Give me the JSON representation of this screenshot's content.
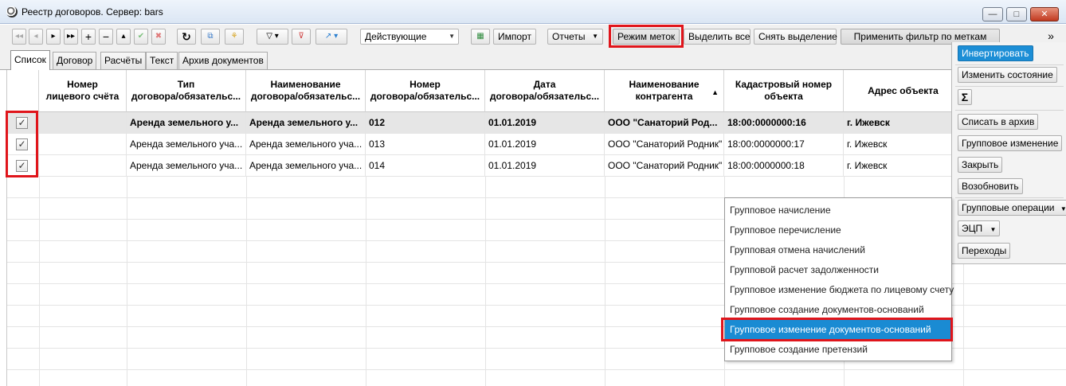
{
  "window": {
    "title": "Реестр договоров. Сервер: bars"
  },
  "toolbar": {
    "status_filter": "Действующие",
    "import_label": "Импорт",
    "reports_label": "Отчеты",
    "mark_mode_label": "Режим меток",
    "select_all_label": "Выделить все",
    "clear_selection_label": "Снять выделение",
    "apply_filter_label": "Применить фильтр по меткам",
    "overflow_label": "»"
  },
  "tabs": [
    "Список",
    "Договор",
    "Расчёты",
    "Текст",
    "Архив документов"
  ],
  "table": {
    "columns": [
      "Номер\nлицевого счёта",
      "Тип\nдоговора/обязательс...",
      "Наименование\nдоговора/обязательс...",
      "Номер\nдоговора/обязательс...",
      "Дата\nдоговора/обязательс...",
      "Наименование\nконтрагента",
      "Кадастровый номер\nобъекта",
      "Адрес объекта"
    ],
    "sorted_column_indicator": "▲",
    "rows": [
      {
        "checked": "✓",
        "cells": [
          "",
          "Аренда земельного у...",
          "Аренда земельного у...",
          "012",
          "01.01.2019",
          "ООО \"Санаторий Род...",
          "18:00:0000000:16",
          "г. Ижевск"
        ]
      },
      {
        "checked": "✓",
        "cells": [
          "",
          "Аренда земельного уча...",
          "Аренда земельного уча...",
          "013",
          "01.01.2019",
          "ООО \"Санаторий Родник\"",
          "18:00:0000000:17",
          "г. Ижевск"
        ]
      },
      {
        "checked": "✓",
        "cells": [
          "",
          "Аренда земельного уча...",
          "Аренда земельного уча...",
          "014",
          "01.01.2019",
          "ООО \"Санаторий Родник\"",
          "18:00:0000000:18",
          "г. Ижевск"
        ]
      }
    ]
  },
  "side_panel": {
    "invert": "Инвертировать",
    "change_state": "Изменить состояние",
    "sum_icon": "Σ",
    "archive": "Списать в архив",
    "group_change": "Групповое изменение",
    "close": "Закрыть",
    "resume": "Возобновить",
    "group_ops": "Групповые операции",
    "eds": "ЭЦП",
    "transitions": "Переходы"
  },
  "group_menu": {
    "items": [
      "Групповое начисление",
      "Групповое перечисление",
      "Групповая отмена начислений",
      "Групповой расчет задолженности",
      "Групповое изменение бюджета по лицевому счету",
      "Групповое создание документов-оснований",
      "Групповое изменение документов-оснований",
      "Групповое создание претензий"
    ],
    "highlighted_index": 6
  },
  "colors": {
    "accent": "#1a8bd3",
    "highlight_frame": "#e0151b"
  }
}
